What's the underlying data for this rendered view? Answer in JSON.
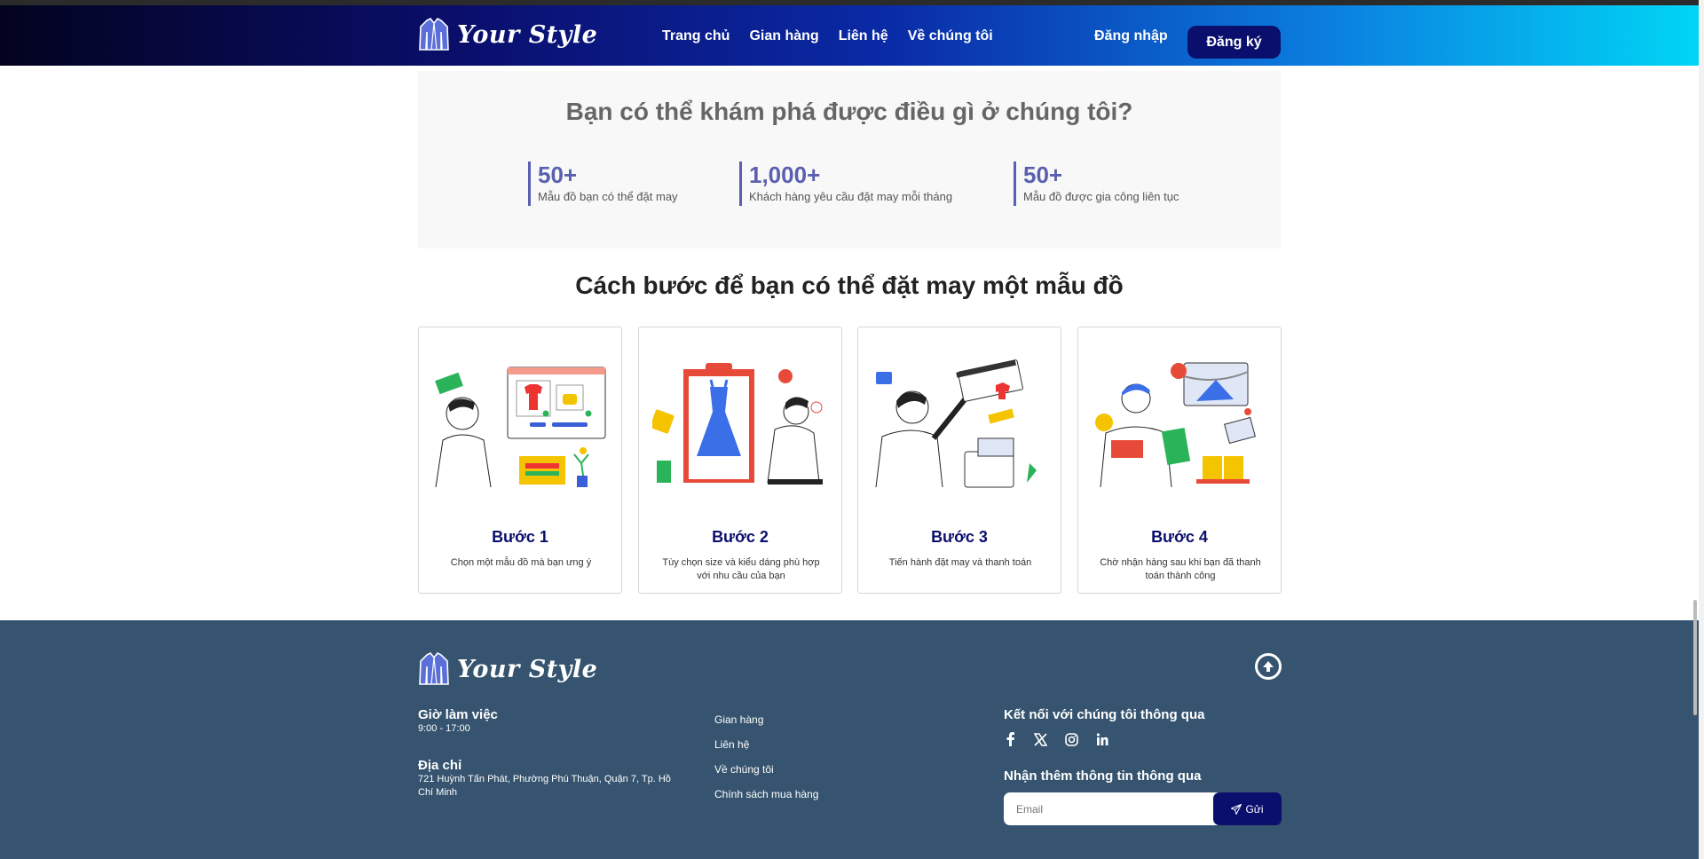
{
  "header": {
    "brand": "Your Style",
    "nav": [
      "Trang chủ",
      "Gian hàng",
      "Liên hệ",
      "Về chúng tôi"
    ],
    "login": "Đăng nhập",
    "signup": "Đăng ký"
  },
  "explore": {
    "title": "Bạn có thể khám phá được điều gì ở chúng tôi?",
    "stats": [
      {
        "num": "50+",
        "label": "Mẫu đồ bạn có thể đặt may"
      },
      {
        "num": "1,000+",
        "label": "Khách hàng yêu cầu đặt may mỗi tháng"
      },
      {
        "num": "50+",
        "label": "Mẫu đồ được gia công liên tục"
      }
    ]
  },
  "steps": {
    "title": "Cách bước để bạn có thể đặt may một mẫu đồ",
    "cards": [
      {
        "title": "Bước 1",
        "desc": "Chọn một mẫu đồ mà bạn ưng ý"
      },
      {
        "title": "Bước 2",
        "desc": "Tùy chọn size và kiểu dáng phù hợp với nhu cầu của bạn"
      },
      {
        "title": "Bước 3",
        "desc": "Tiến hành đặt may và thanh toán"
      },
      {
        "title": "Bước 4",
        "desc": "Chờ nhận hàng sau khi bạn đã thanh toán thành công"
      }
    ]
  },
  "footer": {
    "brand": "Your Style",
    "hours_title": "Giờ làm việc",
    "hours": "9:00 - 17:00",
    "address_title": "Địa chỉ",
    "address": "721 Huỳnh Tấn Phát, Phường Phú Thuận, Quận 7, Tp. Hồ Chí Minh",
    "links": [
      "Gian hàng",
      "Liên hệ",
      "Về chúng tôi",
      "Chính sách mua hàng"
    ],
    "connect_title": "Kết nối với chúng tôi thông qua",
    "social": [
      "facebook-icon",
      "x-icon",
      "instagram-icon",
      "linkedin-icon"
    ],
    "newsletter_title": "Nhận thêm thông tin thông qua",
    "email_placeholder": "Email",
    "send_label": "Gửi"
  },
  "colors": {
    "primary": "#0a0f6e",
    "accent": "#5a5fb0",
    "footer": "#36546f"
  }
}
